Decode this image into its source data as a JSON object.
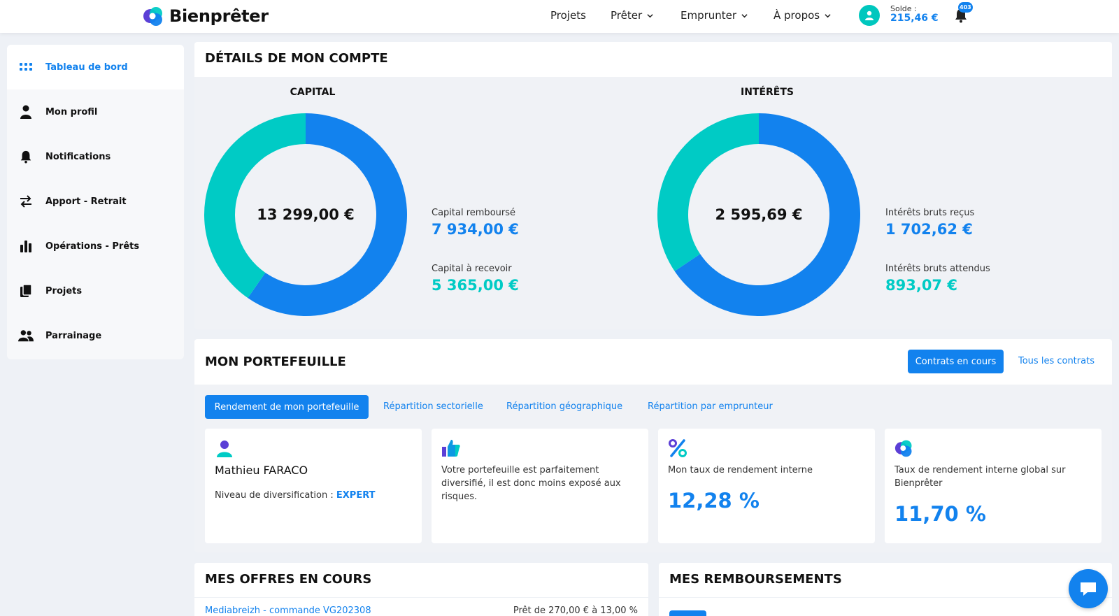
{
  "header": {
    "logo_text": "Bienprêter",
    "nav": [
      {
        "label": "Projets"
      },
      {
        "label": "Prêter"
      },
      {
        "label": "Emprunter"
      },
      {
        "label": "À propos"
      }
    ],
    "solde_label": "Solde :",
    "solde_value": "215,46 €",
    "notification_count": "403",
    "icons": {
      "avatar": "user-icon",
      "notifications": "bell-icon",
      "chevron": "chevron-down-icon"
    }
  },
  "sidebar": {
    "items": [
      {
        "label": "Tableau de bord",
        "icon": "grid-icon",
        "active": true
      },
      {
        "label": "Mon profil",
        "icon": "user-icon"
      },
      {
        "label": "Notifications",
        "icon": "bell-icon"
      },
      {
        "label": "Apport - Retrait",
        "icon": "transfer-icon"
      },
      {
        "label": "Opérations - Prêts",
        "icon": "bar-chart-icon"
      },
      {
        "label": "Projets",
        "icon": "documents-icon"
      },
      {
        "label": "Parrainage",
        "icon": "users-icon"
      }
    ]
  },
  "compte": {
    "title": "DÉTAILS DE MON COMPTE",
    "capital": {
      "title": "CAPITAL",
      "total": "13 299,00 €",
      "legend": [
        {
          "label": "Capital remboursé",
          "value": "7 934,00 €",
          "color": "#1282ee"
        },
        {
          "label": "Capital à recevoir",
          "value": "5 365,00 €",
          "color": "#00cbc5"
        }
      ]
    },
    "interets": {
      "title": "INTÉRÊTS",
      "total": "2 595,69 €",
      "legend": [
        {
          "label": "Intérêts bruts reçus",
          "value": "1 702,62 €",
          "color": "#1282ee"
        },
        {
          "label": "Intérêts bruts attendus",
          "value": "893,07 €",
          "color": "#00cbc5"
        }
      ]
    }
  },
  "chart_data": [
    {
      "type": "pie",
      "title": "CAPITAL",
      "categories": [
        "Capital remboursé",
        "Capital à recevoir"
      ],
      "values": [
        7934.0,
        5365.0
      ],
      "colors": [
        "#1282ee",
        "#00cbc5"
      ]
    },
    {
      "type": "pie",
      "title": "INTÉRÊTS",
      "categories": [
        "Intérêts bruts reçus",
        "Intérêts bruts attendus"
      ],
      "values": [
        1702.62,
        893.07
      ],
      "colors": [
        "#1282ee",
        "#00cbc5"
      ]
    }
  ],
  "portefeuille": {
    "title": "MON PORTEFEUILLE",
    "btn_en_cours": "Contrats en cours",
    "link_tous": "Tous les contrats",
    "tabs": [
      {
        "label": "Rendement de mon portefeuille",
        "active": true
      },
      {
        "label": "Répartition sectorielle"
      },
      {
        "label": "Répartition géographique"
      },
      {
        "label": "Répartition par emprunteur"
      }
    ],
    "cards": {
      "profile": {
        "icon": "user-icon",
        "name": "Mathieu FARACO",
        "niveau_label": "Niveau de diversification :",
        "niveau_value": "EXPERT"
      },
      "diversif": {
        "icon": "thumbs-up-icon",
        "text": "Votre portefeuille est parfaitement diversifié, il est donc moins exposé aux risques."
      },
      "taux": {
        "icon": "percent-icon",
        "label": "Mon taux de rendement interne",
        "value": "12,28 %"
      },
      "global": {
        "icon": "bienpreter-logo-icon",
        "label": "Taux de rendement interne global sur Bienprêter",
        "value": "11,70 %"
      }
    }
  },
  "offres": {
    "title": "MES OFFRES EN COURS",
    "row": {
      "name": "Mediabreizh - commande VG202308",
      "detail": "Prêt de 270,00 € à 13,00 %"
    }
  },
  "remboursements": {
    "title": "MES REMBOURSEMENTS"
  },
  "chat": {
    "icon": "chat-icon"
  }
}
